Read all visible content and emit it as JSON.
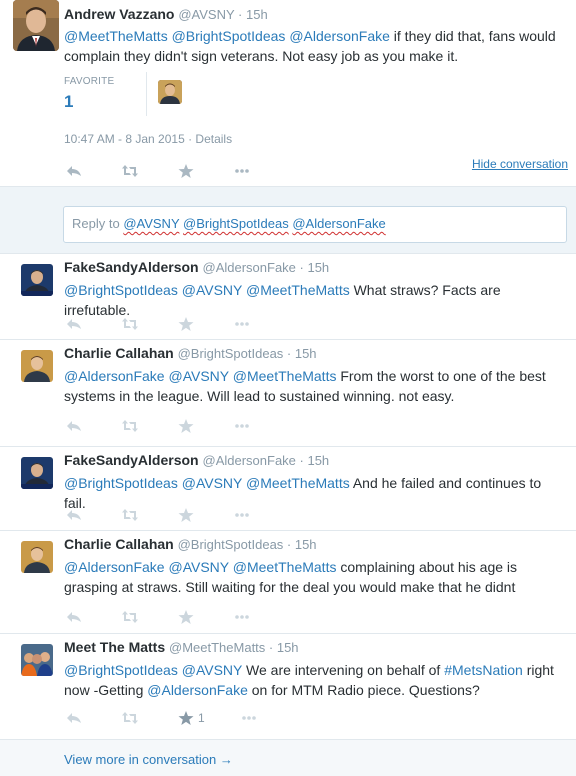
{
  "main_tweet": {
    "fullname": "Andrew Vazzano",
    "handle_time": "@AVSNY · 15h",
    "text_parts": [
      "@MeetTheMatts",
      " ",
      "@BrightSpotIdeas",
      " ",
      "@AldersonFake",
      " if they did that, fans would complain they didn't sign veterans. Not easy job as you make it."
    ],
    "stat_label": "FAVORITE",
    "stat_value": "1",
    "timestamp": "10:47 AM - 8 Jan 2015 · Details",
    "hide_conversation": "Hide conversation"
  },
  "reply_box": {
    "prefix": "Reply to ",
    "mentions": [
      "@AVSNY",
      "@BrightSpotIdeas",
      "@AldersonFake"
    ]
  },
  "replies": [
    {
      "fullname": "FakeSandyAlderson",
      "handle_time": "@AldersonFake · 15h",
      "line1": [
        "@BrightSpotIdeas",
        " ",
        "@AVSNY",
        " ",
        "@MeetTheMatts",
        " What straws? Facts are irrefutable."
      ],
      "fav_count": ""
    },
    {
      "fullname": "Charlie Callahan",
      "handle_time": "@BrightSpotIdeas · 15h",
      "line1": [
        "@AldersonFake",
        " ",
        "@AVSNY",
        " ",
        "@MeetTheMatts",
        " From the worst to one of the best systems in the league. Will lead to sustained winning. not easy."
      ],
      "fav_count": ""
    },
    {
      "fullname": "FakeSandyAlderson",
      "handle_time": "@AldersonFake · 15h",
      "line1": [
        "@BrightSpotIdeas",
        " ",
        "@AVSNY",
        " ",
        "@MeetTheMatts",
        " And he failed and continues to fail."
      ],
      "fav_count": ""
    },
    {
      "fullname": "Charlie Callahan",
      "handle_time": "@BrightSpotIdeas · 15h",
      "line1": [
        "@AldersonFake",
        " ",
        "@AVSNY",
        " ",
        "@MeetTheMatts",
        " complaining about his age is grasping at straws. Still waiting for the deal you would make that he didnt"
      ],
      "fav_count": ""
    },
    {
      "fullname": "Meet The Matts",
      "handle_time": "@MeetTheMatts · 15h",
      "line1": [
        "@BrightSpotIdeas",
        " ",
        "@AVSNY",
        " We are intervening on behalf of ",
        "#MetsNation",
        " right now -Getting ",
        "@AldersonFake",
        " on for MTM Radio piece. Questions?"
      ],
      "fav_count": "1"
    }
  ],
  "view_more": "View more in conversation →",
  "colors": {
    "link": "#2b7bb9",
    "muted": "#8899a6",
    "text": "#292f33",
    "border": "#e1e8ed"
  }
}
